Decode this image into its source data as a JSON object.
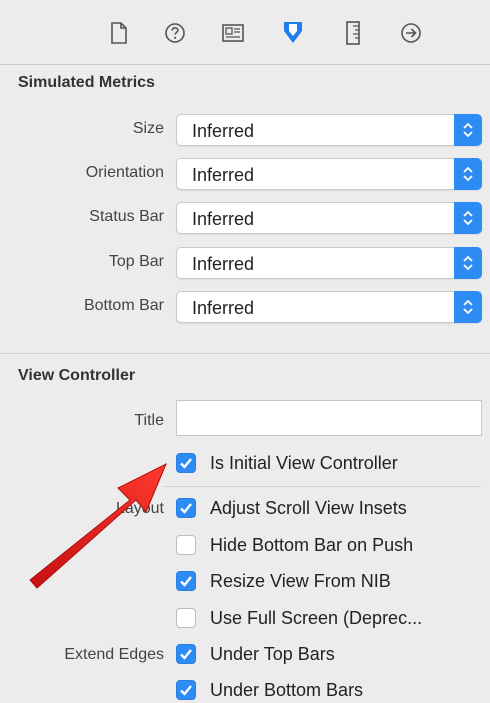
{
  "toolbar": {
    "icons": [
      "file-inspector-icon",
      "quick-help-icon",
      "identity-inspector-icon",
      "attributes-inspector-icon",
      "size-inspector-icon",
      "connections-inspector-icon"
    ]
  },
  "simulated_metrics": {
    "heading": "Simulated Metrics",
    "rows": [
      {
        "label": "Size",
        "value": "Inferred"
      },
      {
        "label": "Orientation",
        "value": "Inferred"
      },
      {
        "label": "Status Bar",
        "value": "Inferred"
      },
      {
        "label": "Top Bar",
        "value": "Inferred"
      },
      {
        "label": "Bottom Bar",
        "value": "Inferred"
      }
    ]
  },
  "view_controller": {
    "heading": "View Controller",
    "title_label": "Title",
    "title_value": "",
    "initial_label": "Is Initial View Controller",
    "layout_label": "Layout",
    "extend_edges_label": "Extend Edges",
    "checkboxes": [
      {
        "label": "Adjust Scroll View Insets",
        "checked": true
      },
      {
        "label": "Hide Bottom Bar on Push",
        "checked": false
      },
      {
        "label": "Resize View From NIB",
        "checked": true
      },
      {
        "label": "Use Full Screen (Deprec...",
        "checked": false
      },
      {
        "label": "Under Top Bars",
        "checked": true
      },
      {
        "label": "Under Bottom Bars",
        "checked": true
      }
    ]
  },
  "colors": {
    "accent": "#2d8bf5",
    "annotation_arrow": "#e8201e",
    "background": "#ececec"
  }
}
